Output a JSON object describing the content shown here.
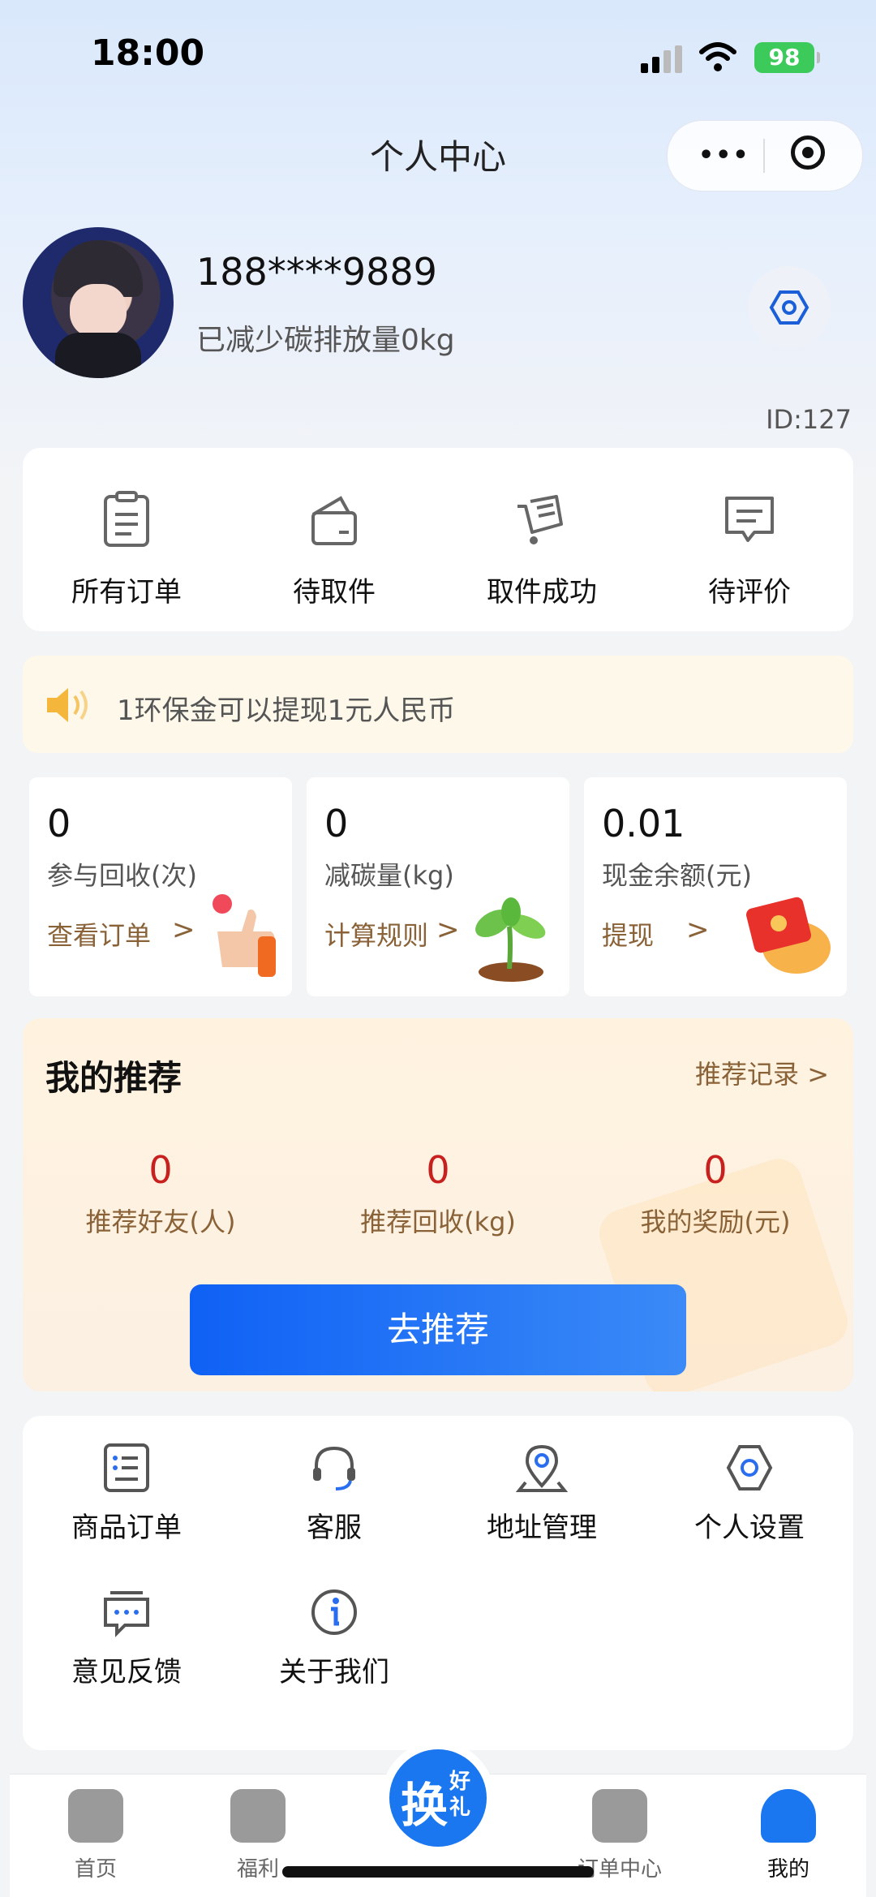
{
  "status_bar": {
    "time": "18:00",
    "battery": "98"
  },
  "header": {
    "title": "个人中心"
  },
  "profile": {
    "phone": "188****9889",
    "carbon_text": "已减少碳排放量0kg",
    "user_id": "ID:127"
  },
  "orders": [
    {
      "label": "所有订单",
      "icon": "clipboard-icon"
    },
    {
      "label": "待取件",
      "icon": "wallet-box-icon"
    },
    {
      "label": "取件成功",
      "icon": "cart-icon"
    },
    {
      "label": "待评价",
      "icon": "message-icon"
    }
  ],
  "notice": {
    "text": "1环保金可以提现1元人民币"
  },
  "stats": [
    {
      "value": "0",
      "label": "参与回收(次)",
      "action": "查看订单"
    },
    {
      "value": "0",
      "label": "减碳量(kg)",
      "action": "计算规则"
    },
    {
      "value": "0.01",
      "label": "现金余额(元)",
      "action": "提现"
    }
  ],
  "recommend": {
    "title": "我的推荐",
    "history_label": "推荐记录",
    "stats": [
      {
        "value": "0",
        "label": "推荐好友(人)"
      },
      {
        "value": "0",
        "label": "推荐回收(kg)"
      },
      {
        "value": "0",
        "label": "我的奖励(元)"
      }
    ],
    "button_label": "去推荐"
  },
  "services": [
    {
      "label": "商品订单",
      "icon": "list-icon"
    },
    {
      "label": "客服",
      "icon": "headset-icon"
    },
    {
      "label": "地址管理",
      "icon": "location-icon"
    },
    {
      "label": "个人设置",
      "icon": "gear-icon"
    },
    {
      "label": "意见反馈",
      "icon": "feedback-icon"
    },
    {
      "label": "关于我们",
      "icon": "info-icon"
    }
  ],
  "tabbar": {
    "items": [
      {
        "label": "首页"
      },
      {
        "label": "福利"
      },
      {
        "label": "订单中心"
      },
      {
        "label": "我的"
      }
    ],
    "center": {
      "big": "换",
      "small": "好礼"
    }
  },
  "colors": {
    "accent": "#1a77f0",
    "price_red": "#c81f1f",
    "brown": "#8a6238"
  }
}
